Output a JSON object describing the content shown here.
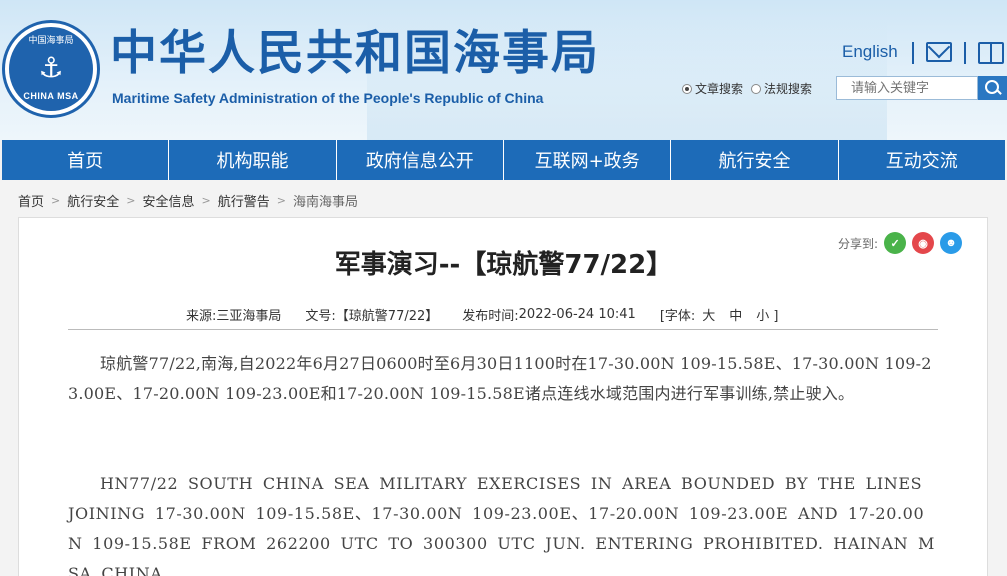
{
  "header": {
    "logo_top_text": "中国海事局",
    "logo_bottom_text": "CHINA MSA",
    "title": "中华人民共和国海事局",
    "subtitle": "Maritime Safety Administration of the People's Republic of China",
    "english_link": "English",
    "mail_icon": "mail-icon",
    "book_icon": "book-icon",
    "search": {
      "options": [
        {
          "label": "文章搜索",
          "selected": true
        },
        {
          "label": "法规搜索",
          "selected": false
        }
      ],
      "placeholder": "请输入关键字",
      "button_icon": "search-icon"
    }
  },
  "nav": {
    "items": [
      "首页",
      "机构职能",
      "政府信息公开",
      "互联网+政务",
      "航行安全",
      "互动交流"
    ]
  },
  "breadcrumb": [
    "首页",
    "航行安全",
    "安全信息",
    "航行警告",
    "海南海事局"
  ],
  "share": {
    "label": "分享到:",
    "icons": [
      "wechat-icon",
      "weibo-icon",
      "qq-icon"
    ]
  },
  "article": {
    "title": "军事演习--【琼航警77/22】",
    "meta": {
      "source_label": "来源:",
      "source": "三亚海事局",
      "doc_label": "文号:",
      "doc_no": "【琼航警77/22】",
      "time_label": "发布时间:",
      "time": "2022-06-24 10:41",
      "font_label": "[字体:",
      "font_large": "大",
      "font_medium": "中",
      "font_small": "小 ]"
    },
    "para_cn": "琼航警77/22,南海,自2022年6月27日0600时至6月30日1100时在17-30.00N 109-15.58E、17-30.00N 109-23.00E、17-20.00N 109-23.00E和17-20.00N 109-15.58E诸点连线水域范围内进行军事训练,禁止驶入。",
    "para_en": "HN77/22 SOUTH CHINA SEA  MILITARY EXERCISES  IN AREA BOUNDED BY THE LINES JOINING 17-30.00N 109-15.58E、17-30.00N 109-23.00E、17-20.00N 109-23.00E  AND  17-20.00N 109-15.58E FROM  262200  UTC  TO  300300  UTC  JUN.  ENTERING PROHIBITED. HAINAN MSA CHINA."
  },
  "colors": {
    "brand_blue": "#1b5ea8",
    "nav_blue": "#1d6bb8"
  }
}
